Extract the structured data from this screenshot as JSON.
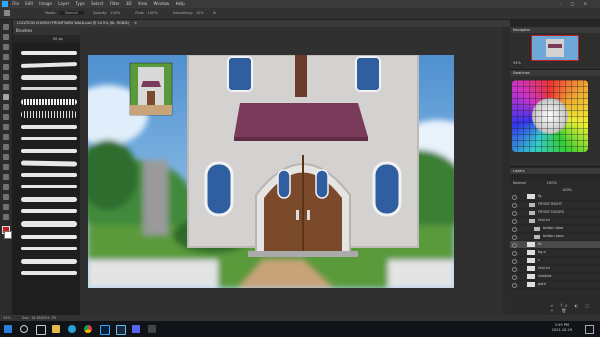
{
  "menu": [
    "File",
    "Edit",
    "Image",
    "Layer",
    "Type",
    "Select",
    "Filter",
    "3D",
    "View",
    "Window",
    "Help"
  ],
  "options": {
    "mode_label": "Mode:",
    "mode_value": "Normal",
    "opacity_label": "Opacity:",
    "opacity_value": "100%",
    "flow_label": "Flow:",
    "flow_value": "100%",
    "smoothing_label": "Smoothing:",
    "smoothing_value": "10%"
  },
  "document": {
    "tab_title": "LOCATION CHURCH FRONTYARD WALK.psd @ 54.5% (fb, RGB/8)"
  },
  "brush_panel": {
    "title": "Brushes",
    "size_value": "50 px"
  },
  "navigator": {
    "title": "Navigator",
    "zoom": "54%"
  },
  "swatches": {
    "title": "Swatches"
  },
  "layers": {
    "title": "Layers",
    "blend_mode": "Normal",
    "opacity": "100%",
    "fill": "100%",
    "rows": [
      {
        "name": "fg",
        "kind": "layer"
      },
      {
        "name": "FRONT RIGHT",
        "kind": "folder"
      },
      {
        "name": "FRONT DOORS",
        "kind": "folder"
      },
      {
        "name": "church",
        "kind": "folder"
      },
      {
        "name": "button door",
        "kind": "folder"
      },
      {
        "name": "button pass",
        "kind": "folder"
      },
      {
        "name": "fb",
        "kind": "layer"
      },
      {
        "name": "bg a",
        "kind": "layer"
      },
      {
        "name": "c",
        "kind": "layer"
      },
      {
        "name": "church",
        "kind": "layer"
      },
      {
        "name": "shadow",
        "kind": "layer"
      },
      {
        "name": "path",
        "kind": "layer"
      }
    ]
  },
  "status": {
    "zoom": "54%",
    "doc_size": "Doc: 18.8M/554.7M"
  },
  "taskbar": {
    "time": "2:59 PM",
    "date": "2021-10-29"
  },
  "colors": {
    "accent": "#31a8ff",
    "roof": "#7a3a5a",
    "door": "#7a4a2a"
  }
}
